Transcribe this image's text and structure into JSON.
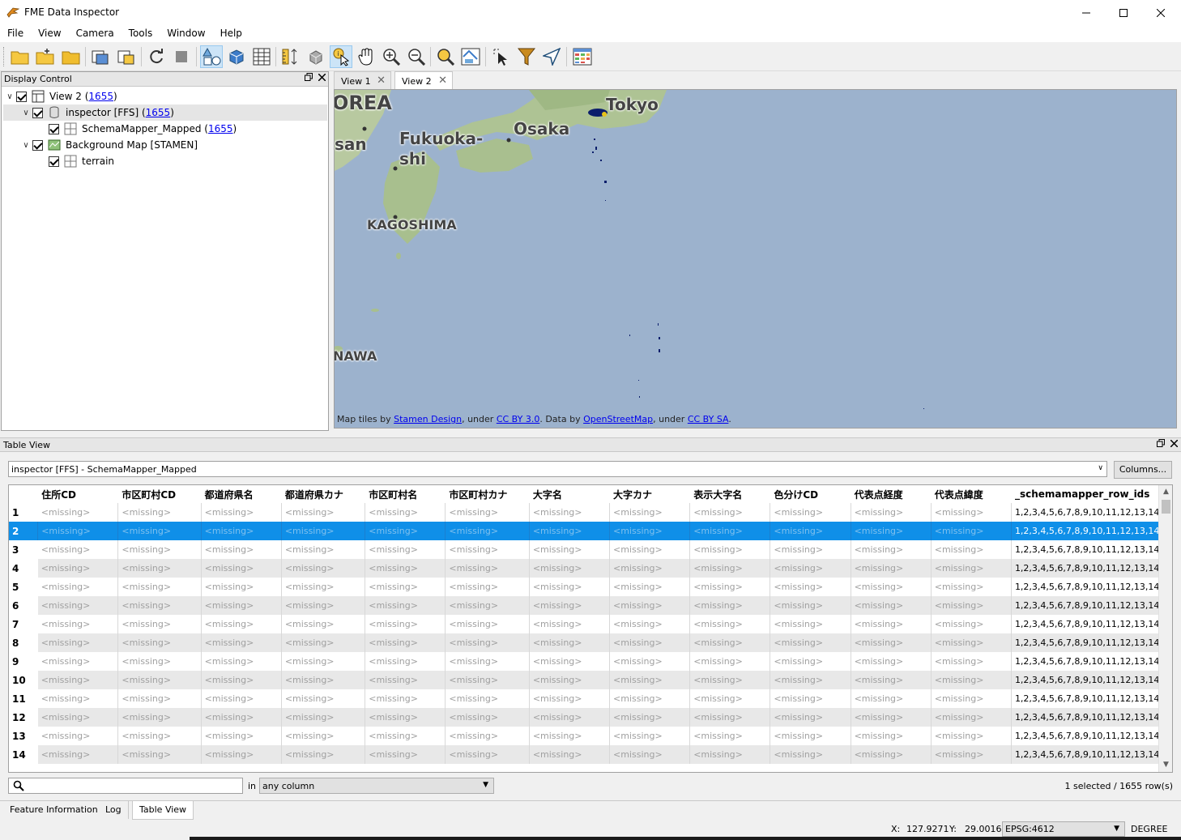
{
  "window": {
    "title": "FME Data Inspector",
    "minimize_icon": "minimize-icon",
    "maximize_icon": "maximize-icon",
    "close_icon": "close-icon"
  },
  "menu": [
    "File",
    "View",
    "Camera",
    "Tools",
    "Window",
    "Help"
  ],
  "toolbar_icons": [
    "open-folder-icon",
    "add-dataset-icon",
    "folder-icon",
    "copy-view-icon",
    "paste-view-icon",
    "refresh-icon",
    "stop-icon",
    "2d-view-icon",
    "3d-view-icon",
    "table-view-icon",
    "ruler-icon",
    "orbit-icon",
    "select-icon",
    "pan-icon",
    "zoom-in-icon",
    "zoom-out-icon",
    "zoom-selected-icon",
    "zoom-extents-icon",
    "select-features-icon",
    "filter-icon",
    "navigate-icon",
    "background-map-icon"
  ],
  "display_control": {
    "title": "Display Control",
    "tree": [
      {
        "label": "View 2 ( ",
        "count": "1655",
        "suffix": " )"
      },
      {
        "label": "inspector [FFS] ( ",
        "count": "1655",
        "suffix": " )"
      },
      {
        "label": "SchemaMapper_Mapped ( ",
        "count": "1655",
        "suffix": " )"
      },
      {
        "label": "Background Map [STAMEN]"
      },
      {
        "label": "terrain"
      }
    ]
  },
  "view_tabs": [
    {
      "label": "View 1",
      "active": false
    },
    {
      "label": "View 2",
      "active": true
    }
  ],
  "map": {
    "labels": [
      "OREA",
      "san",
      "Fukuoka-",
      "shi",
      "Osaka",
      "Tokyo",
      "KAGOSHIMA",
      "NAWA"
    ],
    "attribution": {
      "prefix": "Map tiles by ",
      "link1": "Stamen Design",
      "mid1": ", under ",
      "link2": "CC BY 3.0",
      "mid2": ". Data by ",
      "link3": "OpenStreetMap",
      "mid3": ", under ",
      "link4": "CC BY SA",
      "suffix": "."
    }
  },
  "table_view": {
    "title": "Table View",
    "dataset": "inspector [FFS] - SchemaMapper_Mapped",
    "columns_button": "Columns...",
    "headers": [
      "住所CD",
      "市区町村CD",
      "都道府県名",
      "都道府県カナ",
      "市区町村名",
      "市区町村カナ",
      "大字名",
      "大字カナ",
      "表示大字名",
      "色分けCD",
      "代表点経度",
      "代表点緯度",
      "_schemamapper_row_ids"
    ],
    "missing": "<missing>",
    "row_ids_value": "1,2,3,4,5,6,7,8,9,10,11,12,13,14...",
    "rows": [
      "1",
      "2",
      "3",
      "4",
      "5",
      "6",
      "7",
      "8",
      "9",
      "10",
      "11",
      "12",
      "13",
      "14"
    ],
    "selected_row": "2",
    "search_placeholder": "",
    "in_label": "in",
    "column_filter": "any column",
    "selection_status": "1 selected / 1655 row(s)"
  },
  "bottom_tabs": [
    {
      "label": "Feature Information",
      "active": false
    },
    {
      "label": "Log",
      "active": false
    },
    {
      "label": "Table View",
      "active": true
    }
  ],
  "status": {
    "x_label": "X:",
    "x_value": "127.9271",
    "y_label": "Y:",
    "y_value": "29.0016",
    "crs": "EPSG:4612",
    "units": "DEGREE"
  }
}
